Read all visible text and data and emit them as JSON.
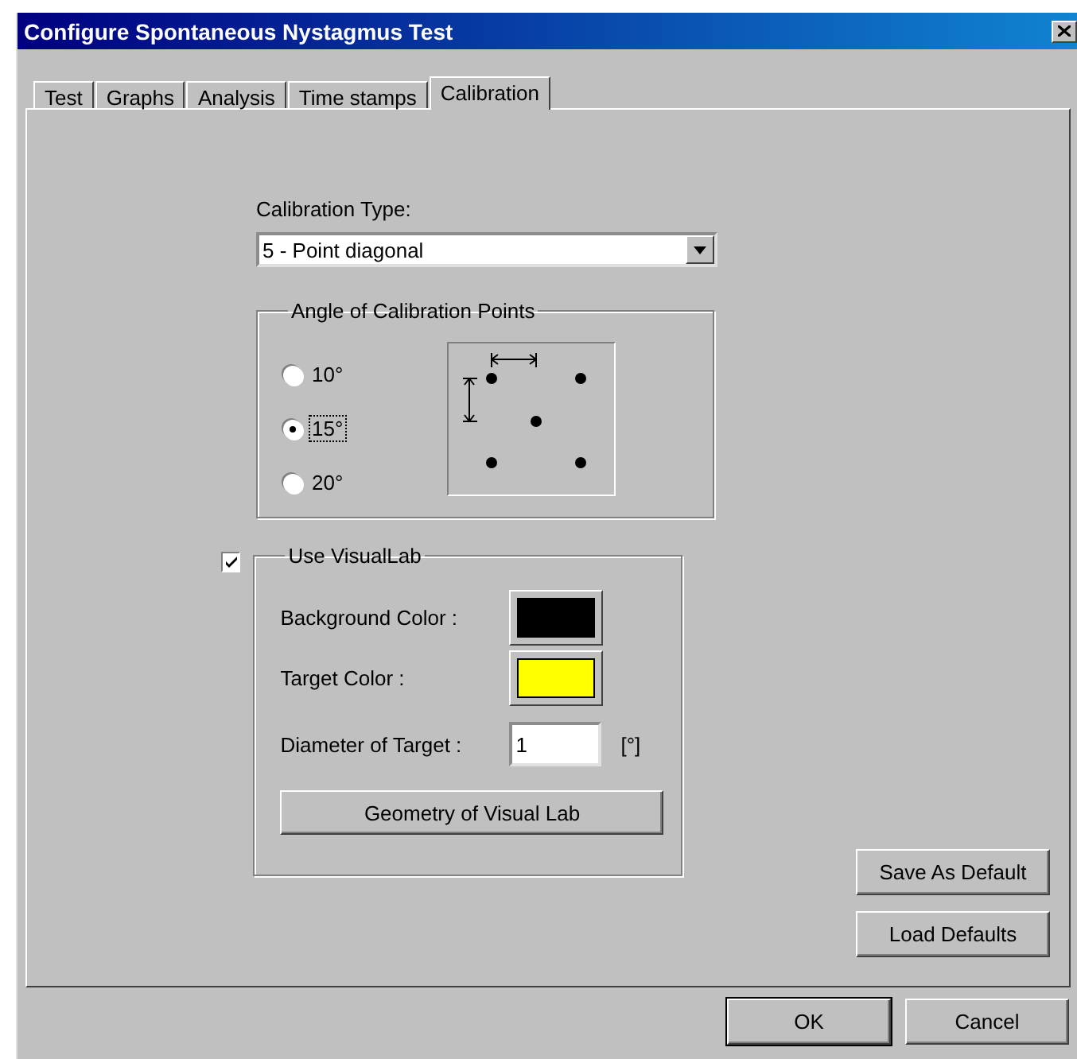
{
  "window": {
    "title": "Configure Spontaneous Nystagmus Test"
  },
  "tabs": [
    {
      "label": "Test",
      "selected": false
    },
    {
      "label": "Graphs",
      "selected": false
    },
    {
      "label": "Analysis",
      "selected": false
    },
    {
      "label": "Time stamps",
      "selected": false
    },
    {
      "label": "Calibration",
      "selected": true
    }
  ],
  "calibration_type": {
    "label": "Calibration Type:",
    "value": "5 - Point diagonal"
  },
  "angle_group": {
    "title": "Angle of Calibration Points",
    "options": [
      {
        "label": "10°",
        "selected": false
      },
      {
        "label": "15°",
        "selected": true
      },
      {
        "label": "20°",
        "selected": false
      }
    ]
  },
  "visuallab": {
    "label": "Use VisualLab",
    "checked": true,
    "colors": [
      {
        "label": "Background Color :",
        "color": "#000000"
      },
      {
        "label": "Target Color :",
        "color": "#ffff00"
      }
    ],
    "diameter": {
      "label": "Diameter of Target :",
      "value": "1",
      "unit": "[°]"
    },
    "geometry_button": "Geometry of Visual Lab"
  },
  "side_buttons": [
    "Save As Default",
    "Load Defaults"
  ],
  "buttons": [
    "OK",
    "Cancel"
  ]
}
